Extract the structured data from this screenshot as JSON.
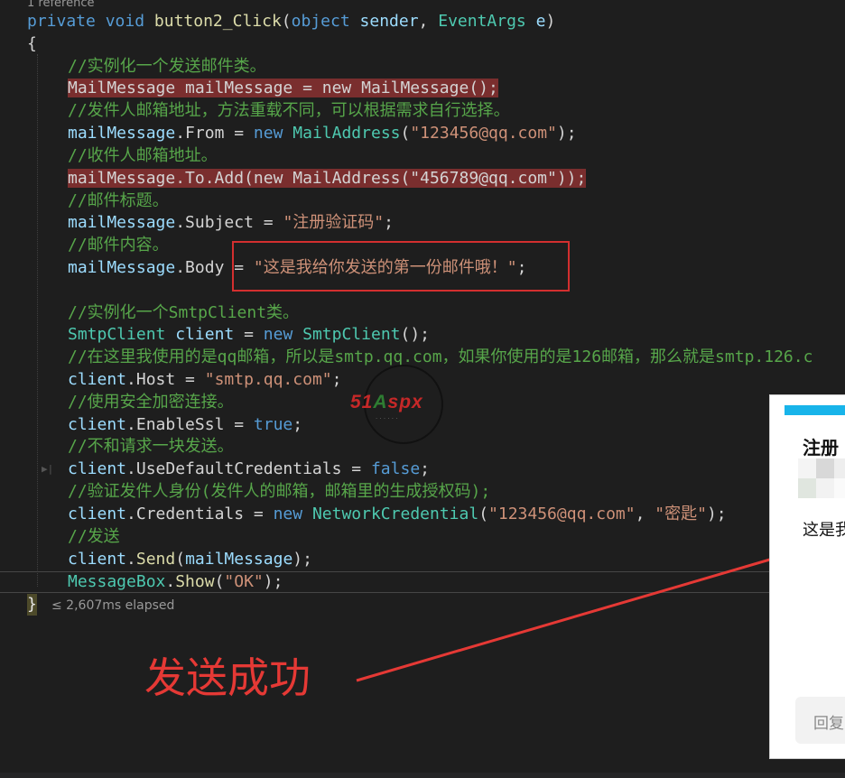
{
  "codelens": "1 reference",
  "signature": {
    "mod1": "private",
    "mod2": "void",
    "method": "button2_Click",
    "open": "(",
    "type1": "object",
    "param1": "sender",
    "comma": ",",
    "type2": "EventArgs",
    "param2": "e",
    "close": ")"
  },
  "open_brace": "{",
  "close_brace": "}",
  "code": {
    "c1": "//实例化一个发送邮件类。",
    "l1": "MailMessage mailMessage = new MailMessage();",
    "c2": "//发件人邮箱地址，方法重载不同，可以根据需求自行选择。",
    "l2_var": "mailMessage",
    "l2_prop": ".From = ",
    "l2_new": "new",
    "l2_type": "MailAddress",
    "l2_open": "(",
    "l2_str": "\"123456@qq.com\"",
    "l2_end": ");",
    "c3": "//收件人邮箱地址。",
    "l3": "mailMessage.To.Add(new MailAddress(\"456789@qq.com\"));",
    "c4": "//邮件标题。",
    "l4_var": "mailMessage",
    "l4_prop": ".Subject = ",
    "l4_str": "\"注册验证码\"",
    "l4_end": ";",
    "c5": "//邮件内容。",
    "l5_var": "mailMessage",
    "l5_prop": ".Body = ",
    "l5_str": "\"这是我给你发送的第一份邮件哦！\"",
    "l5_end": ";",
    "c6": "//实例化一个SmtpClient类。",
    "l6_type": "SmtpClient",
    "l6_var": "client",
    "l6_eq": " = ",
    "l6_new": "new",
    "l6_type2": "SmtpClient",
    "l6_end": "();",
    "c7": "//在这里我使用的是qq邮箱，所以是smtp.qq.com，如果你使用的是126邮箱，那么就是smtp.126.c",
    "l7_var": "client",
    "l7_prop": ".Host = ",
    "l7_str": "\"smtp.qq.com\"",
    "l7_end": ";",
    "c8": "//使用安全加密连接。",
    "l8_var": "client",
    "l8_prop": ".EnableSsl = ",
    "l8_val": "true",
    "l8_end": ";",
    "c9": "//不和请求一块发送。",
    "l9_var": "client",
    "l9_prop": ".UseDefaultCredentials = ",
    "l9_val": "false",
    "l9_end": ";",
    "c10": "//验证发件人身份(发件人的邮箱，邮箱里的生成授权码);",
    "l10_var": "client",
    "l10_prop": ".Credentials = ",
    "l10_new": "new",
    "l10_type": "NetworkCredential",
    "l10_open": "(",
    "l10_str1": "\"123456@qq.com\"",
    "l10_comma": ", ",
    "l10_str2": "\"密匙\"",
    "l10_end": ");",
    "c11": "//发送",
    "l11_var": "client",
    "l11_dot": ".",
    "l11_fn": "Send",
    "l11_open": "(",
    "l11_arg": "mailMessage",
    "l11_end": ");",
    "l12_type": "MessageBox",
    "l12_dot": ".",
    "l12_fn": "Show",
    "l12_open": "(",
    "l12_str": "\"OK\"",
    "l12_end": ");"
  },
  "perf_tip": "≤ 2,607ms elapsed",
  "watermark": {
    "part1": "51",
    "part2": "A",
    "part3": "spx"
  },
  "caption": "发送成功",
  "popup": {
    "title": "注册",
    "body": "这是我",
    "reply": "回复"
  },
  "colors": {
    "background": "#1e1e1e",
    "keyword": "#569cd6",
    "type": "#4ec9b0",
    "string": "#ce9178",
    "comment": "#57a64a",
    "highlight_red": "#7a2e2e",
    "annotation_red": "#e53935",
    "popup_bar": "#18b4ea"
  }
}
